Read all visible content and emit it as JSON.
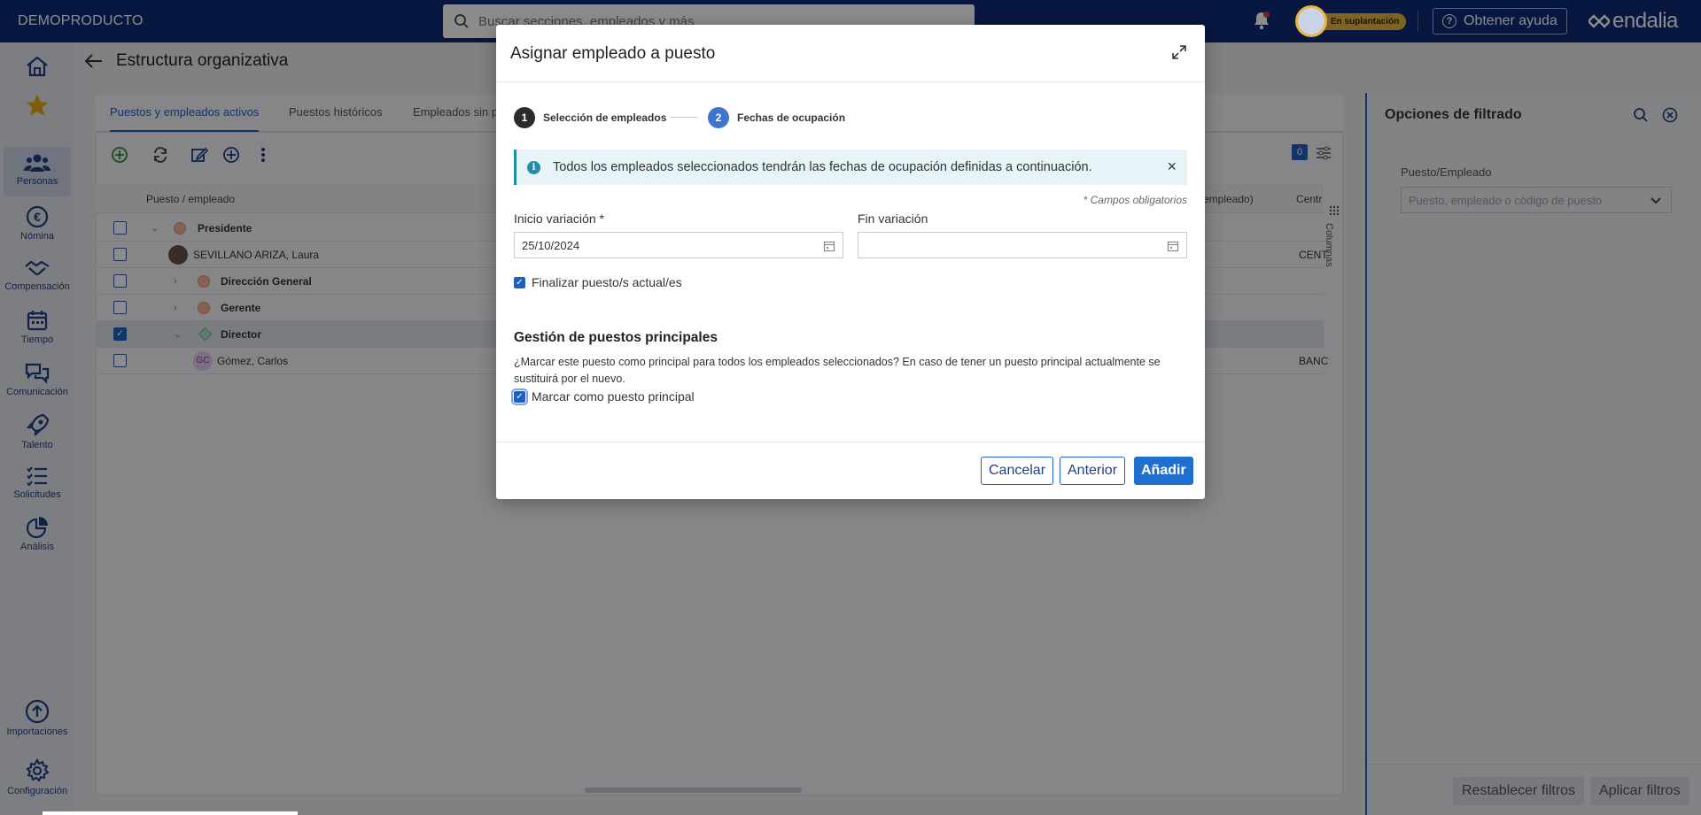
{
  "topbar": {
    "brand": "DEMOPRODUCTO",
    "search_placeholder": "Buscar secciones, empleados y más",
    "impersonation_badge": "En suplantación",
    "help_label": "Obtener ayuda",
    "logo_text": "endalia"
  },
  "sidebar": {
    "items": [
      {
        "label": "",
        "icon": "home-icon"
      },
      {
        "label": "",
        "icon": "star-icon"
      },
      {
        "label": "Personas",
        "icon": "people-icon"
      },
      {
        "label": "Nómina",
        "icon": "euro-icon"
      },
      {
        "label": "Compensación",
        "icon": "handshake-icon"
      },
      {
        "label": "Tiempo",
        "icon": "calendar-icon"
      },
      {
        "label": "Comunicación",
        "icon": "chat-icon"
      },
      {
        "label": "Talento",
        "icon": "rocket-icon"
      },
      {
        "label": "Solicitudes",
        "icon": "list-icon"
      },
      {
        "label": "Análisis",
        "icon": "pie-icon"
      },
      {
        "label": "Importaciones",
        "icon": "upload-icon"
      },
      {
        "label": "Configuración",
        "icon": "gear-icon"
      }
    ]
  },
  "page": {
    "title": "Estructura organizativa",
    "tabs": [
      "Puestos y empleados activos",
      "Puestos históricos",
      "Empleados sin p"
    ],
    "filter_count": "0",
    "columns_label": "Columnas",
    "table": {
      "col_position": "Puesto / empleado",
      "col_employee_partial": "empleado)",
      "col_center_partial": "Centr",
      "rows": [
        {
          "label": "Presidente",
          "type": "position",
          "bold": true,
          "extra": ""
        },
        {
          "label": "SEVILLANO ARIZA, Laura",
          "type": "employee",
          "bold": false,
          "extra": "CENT"
        },
        {
          "label": "Dirección General",
          "type": "position",
          "bold": true,
          "extra": ""
        },
        {
          "label": "Gerente",
          "type": "position",
          "bold": true,
          "extra": ""
        },
        {
          "label": "Director",
          "type": "position",
          "bold": true,
          "extra": ""
        },
        {
          "label": "Gómez, Carlos",
          "type": "employee",
          "bold": false,
          "initials": "GC",
          "extra": "BANC"
        }
      ]
    }
  },
  "filter_panel": {
    "title": "Opciones de filtrado",
    "field_label": "Puesto/Empleado",
    "field_placeholder": "Puesto, empleado o código de puesto",
    "reset_label": "Restablecer filtros",
    "apply_label": "Aplicar filtros"
  },
  "modal": {
    "title": "Asignar empleado a puesto",
    "steps": [
      {
        "num": "1",
        "label": "Selección de empleados"
      },
      {
        "num": "2",
        "label": "Fechas de ocupación"
      }
    ],
    "alert_text": "Todos los empleados seleccionados tendrán las fechas de ocupación definidas a continuación.",
    "required_note": "* Campos obligatorios",
    "start_label": "Inicio variación *",
    "start_value": "25/10/2024",
    "end_label": "Fin variación",
    "end_value": "",
    "finalize_label": "Finalizar puesto/s actual/es",
    "section_title": "Gestión de puestos principales",
    "section_text": "¿Marcar este puesto como principal para todos los empleados seleccionados? En caso de tener un puesto principal actualmente se sustituirá por el nuevo.",
    "principal_label": "Marcar como puesto principal",
    "cancel_label": "Cancelar",
    "back_label": "Anterior",
    "add_label": "Añadir"
  },
  "colors": {
    "topbar": "#0f2a73",
    "accent": "#1f5fbf",
    "impersonation": "#e8b441"
  }
}
